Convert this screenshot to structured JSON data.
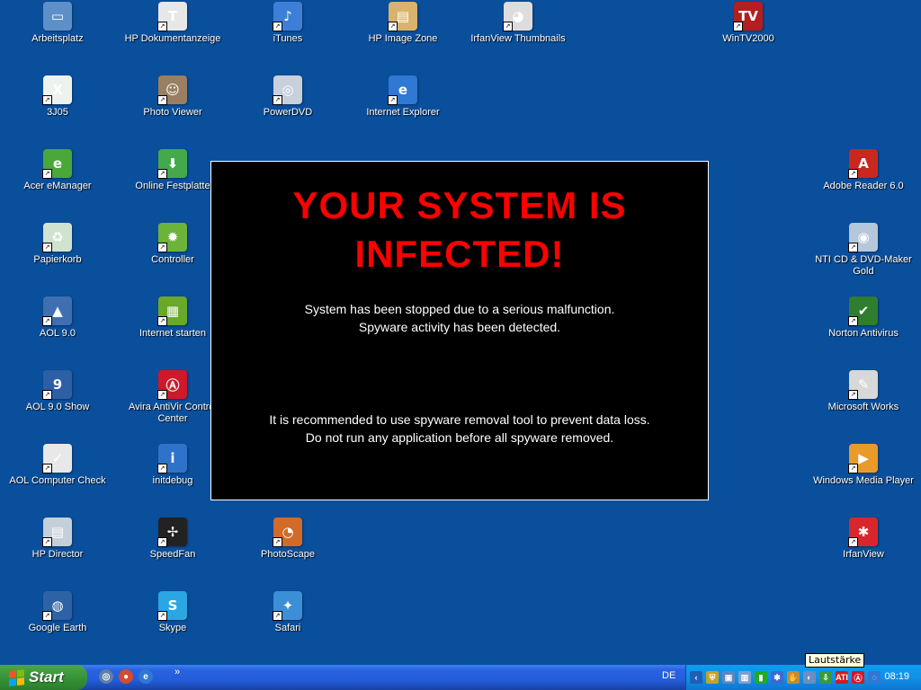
{
  "desktop_icons": [
    {
      "label": "Arbeitsplatz",
      "icon": "my-computer-icon",
      "color": "#5f8fc9",
      "glyph": "▭"
    },
    {
      "label": "HP Dokumentanzeige",
      "icon": "hp-document-viewer-icon",
      "color": "#e7e7e7",
      "glyph": "T"
    },
    {
      "label": "iTunes",
      "icon": "itunes-icon",
      "color": "#3d7fd8",
      "glyph": "♪"
    },
    {
      "label": "HP  Image Zone",
      "icon": "hp-image-zone-icon",
      "color": "#d9b36c",
      "glyph": "▤"
    },
    {
      "label": "IrfanView Thumbnails",
      "icon": "irfanview-thumbnails-icon",
      "color": "#dddddd",
      "glyph": "◕"
    },
    {
      "label": "WinTV2000",
      "icon": "wintv-icon",
      "color": "#b31e1e",
      "glyph": "TV"
    },
    {
      "label": "3J05",
      "icon": "excel-file-icon",
      "color": "#eef2ee",
      "glyph": "X"
    },
    {
      "label": "Photo Viewer",
      "icon": "photo-viewer-icon",
      "color": "#9a7f63",
      "glyph": "☺"
    },
    {
      "label": "PowerDVD",
      "icon": "powerdvd-icon",
      "color": "#c8d0dc",
      "glyph": "◎"
    },
    {
      "label": "Internet Explorer",
      "icon": "internet-explorer-icon",
      "color": "#2f78d4",
      "glyph": "e"
    },
    {
      "label": "Acer eManager",
      "icon": "acer-emanager-icon",
      "color": "#4aa83a",
      "glyph": "e"
    },
    {
      "label": "Online Festplatte",
      "icon": "online-drive-icon",
      "color": "#43a94a",
      "glyph": "⬇"
    },
    {
      "label": "Adobe Reader 6.0",
      "icon": "adobe-reader-icon",
      "color": "#c8281e",
      "glyph": "A"
    },
    {
      "label": "Papierkorb",
      "icon": "recycle-bin-icon",
      "color": "#cfe3cf",
      "glyph": "♻"
    },
    {
      "label": "Controller",
      "icon": "controller-icon",
      "color": "#6cb33a",
      "glyph": "✹"
    },
    {
      "label": "NTI CD & DVD-Maker Gold",
      "icon": "nti-cd-maker-icon",
      "color": "#b6c6db",
      "glyph": "◉"
    },
    {
      "label": "AOL 9.0",
      "icon": "aol-icon",
      "color": "#3f6fb0",
      "glyph": "▲"
    },
    {
      "label": "Internet starten",
      "icon": "internet-start-icon",
      "color": "#6aa82a",
      "glyph": "▦"
    },
    {
      "label": "Norton Antivirus",
      "icon": "norton-antivirus-icon",
      "color": "#2f7d2f",
      "glyph": "✔"
    },
    {
      "label": "AOL 9.0 Show",
      "icon": "aol-show-icon",
      "color": "#2c5fa6",
      "glyph": "9"
    },
    {
      "label": "Avira AntiVir Control Center",
      "icon": "avira-icon",
      "color": "#d1172a",
      "glyph": "Ⓐ"
    },
    {
      "label": "Microsoft Works",
      "icon": "microsoft-works-icon",
      "color": "#d8d8d8",
      "glyph": "✎"
    },
    {
      "label": "AOL Computer Check",
      "icon": "aol-computer-check-icon",
      "color": "#e8e8e8",
      "glyph": "✓"
    },
    {
      "label": "initdebug",
      "icon": "initdebug-icon",
      "color": "#2f72c9",
      "glyph": "i"
    },
    {
      "label": "Windows Media Player",
      "icon": "windows-media-player-icon",
      "color": "#e99b2a",
      "glyph": "▶"
    },
    {
      "label": "HP Director",
      "icon": "hp-director-icon",
      "color": "#c4cfd9",
      "glyph": "▤"
    },
    {
      "label": "SpeedFan",
      "icon": "speedfan-icon",
      "color": "#222222",
      "glyph": "✢"
    },
    {
      "label": "PhotoScape",
      "icon": "photoscape-icon",
      "color": "#d26a28",
      "glyph": "◔"
    },
    {
      "label": "IrfanView",
      "icon": "irfanview-icon",
      "color": "#d9262c",
      "glyph": "✱"
    },
    {
      "label": "Google Earth",
      "icon": "google-earth-icon",
      "color": "#2d63a6",
      "glyph": "◍"
    },
    {
      "label": "Skype",
      "icon": "skype-icon",
      "color": "#2aa6e3",
      "glyph": "S"
    },
    {
      "label": "Safari",
      "icon": "safari-icon",
      "color": "#3b8fd6",
      "glyph": "✦"
    }
  ],
  "popup": {
    "headline_line1": "YOUR SYSTEM IS",
    "headline_line2": "INFECTED!",
    "message1_line1": "System has been stopped due to a serious malfunction.",
    "message1_line2": "Spyware activity has been detected.",
    "message2_line1": "It is recommended to use spyware removal tool to prevent data loss.",
    "message2_line2": "Do not run any application before all spyware removed.",
    "headline_color": "#ff0000",
    "background_color": "#000000"
  },
  "taskbar": {
    "start_label": "Start",
    "quick_launch": [
      {
        "icon": "show-desktop-icon",
        "color": "#5f7fa8",
        "glyph": "◎"
      },
      {
        "icon": "chrome-icon",
        "color": "#d64a2f",
        "glyph": "●"
      },
      {
        "icon": "internet-explorer-icon",
        "color": "#2f78d4",
        "glyph": "e"
      }
    ],
    "quick_launch_more": "»",
    "language": "DE",
    "tray_icons": [
      {
        "icon": "tray-expand-icon",
        "color": "#1f5fb8",
        "glyph": "‹"
      },
      {
        "icon": "security-shield-icon",
        "color": "#c7a12a",
        "glyph": "⛨"
      },
      {
        "icon": "network-icon",
        "color": "#5b86c4",
        "glyph": "▣"
      },
      {
        "icon": "display-icon",
        "color": "#7a9fd0",
        "glyph": "▥"
      },
      {
        "icon": "battery-icon",
        "color": "#22aa22",
        "glyph": "▮"
      },
      {
        "icon": "bluetooth-icon",
        "color": "#3a6ad0",
        "glyph": "✱"
      },
      {
        "icon": "hand-icon",
        "color": "#c28a3a",
        "glyph": "✋"
      },
      {
        "icon": "volume-icon",
        "color": "#6a8fc0",
        "glyph": "◐"
      },
      {
        "icon": "updates-icon",
        "color": "#3a9a3a",
        "glyph": "⇩"
      },
      {
        "icon": "ati-icon",
        "color": "#c81e1e",
        "glyph": "ATI"
      },
      {
        "icon": "avira-tray-icon",
        "color": "#d1172a",
        "glyph": "Ⓐ"
      },
      {
        "icon": "search-icon",
        "color": "#2f78d4",
        "glyph": "◌"
      }
    ],
    "clock": "08:19",
    "tooltip": "Lautstärke"
  }
}
